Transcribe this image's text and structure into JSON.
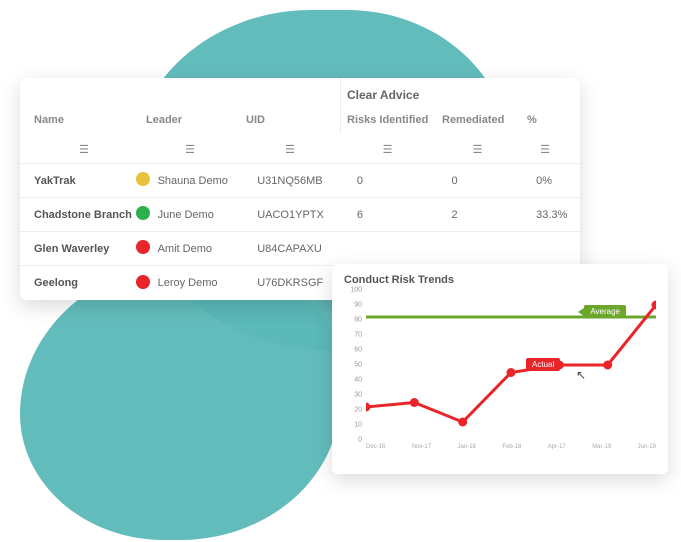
{
  "table": {
    "section_title": "Clear Advice",
    "columns": {
      "name": "Name",
      "leader": "Leader",
      "uid": "UID",
      "risks_identified": "Risks Identified",
      "remediated": "Remediated",
      "percent": "%"
    },
    "rows": [
      {
        "name": "YakTrak",
        "dot": "yellow",
        "leader": "Shauna Demo",
        "uid": "U31NQ56MB",
        "ri": "0",
        "rem": "0",
        "pct": "0%"
      },
      {
        "name": "Chadstone Branch",
        "dot": "green",
        "leader": "June Demo",
        "uid": "UACO1YPTX",
        "ri": "6",
        "rem": "2",
        "pct": "33.3%"
      },
      {
        "name": "Glen Waverley",
        "dot": "red",
        "leader": "Amit Demo",
        "uid": "U84CAPAXU",
        "ri": "",
        "rem": "",
        "pct": ""
      },
      {
        "name": "Geelong",
        "dot": "red",
        "leader": "Leroy Demo",
        "uid": "U76DKRSGF",
        "ri": "",
        "rem": "",
        "pct": ""
      }
    ]
  },
  "chart": {
    "title": "Conduct Risk Trends",
    "legend_average": "Average",
    "legend_actual": "Actual"
  },
  "chart_data": {
    "type": "line",
    "title": "Conduct Risk Trends",
    "xlabel": "",
    "ylabel": "",
    "ylim": [
      0,
      100
    ],
    "categories": [
      "Dec-16",
      "Nov-17",
      "Jan-18",
      "Feb-18",
      "Apr-17",
      "Mar-19",
      "Jun-18"
    ],
    "series": [
      {
        "name": "Actual",
        "values": [
          22,
          25,
          12,
          45,
          50,
          50,
          90
        ],
        "color": "#e8262a"
      },
      {
        "name": "Average",
        "values": [
          82,
          82,
          82,
          82,
          82,
          82,
          82
        ],
        "color": "#6aa72a"
      }
    ],
    "y_ticks": [
      0,
      10,
      20,
      30,
      40,
      50,
      60,
      70,
      80,
      90,
      100
    ]
  }
}
